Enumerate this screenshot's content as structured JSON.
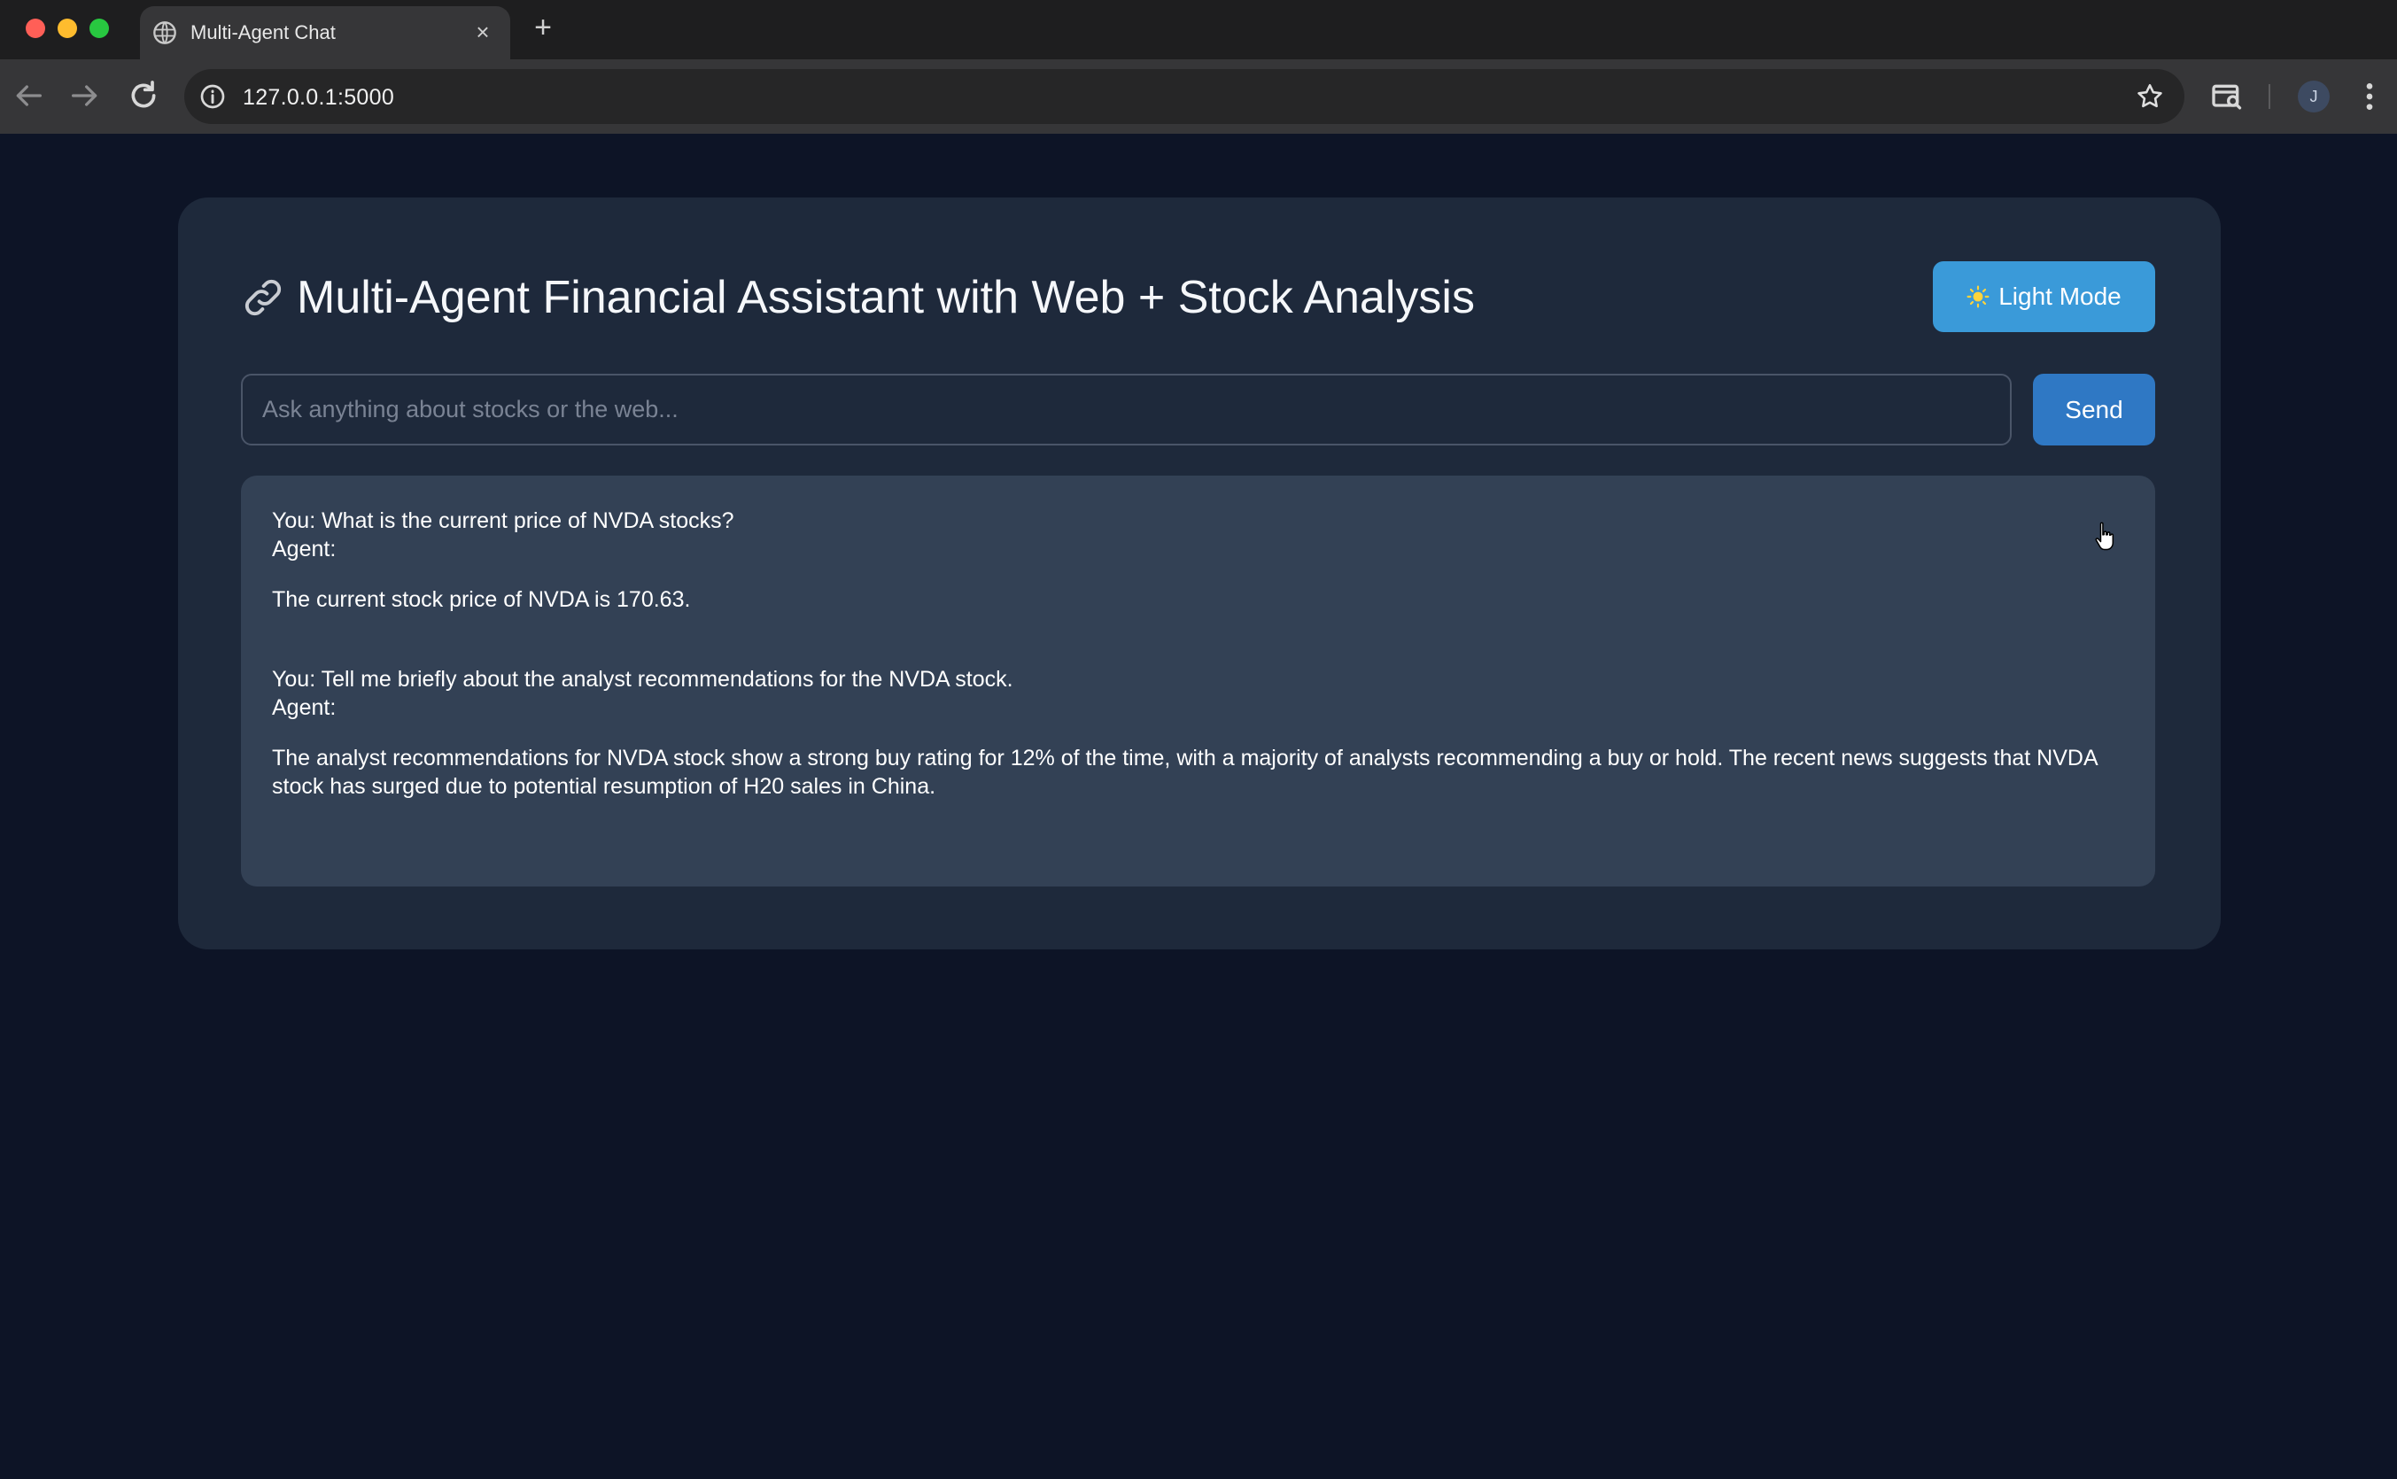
{
  "browser": {
    "tab_title": "Multi-Agent Chat",
    "tab_close": "×",
    "new_tab": "+",
    "url": "127.0.0.1:5000",
    "profile_initial": "J"
  },
  "app": {
    "title": "Multi-Agent Financial Assistant with Web + Stock Analysis",
    "mode_button_label": "Light Mode",
    "input_placeholder": "Ask anything about stocks or the web...",
    "input_value": "",
    "send_label": "Send"
  },
  "chat": [
    {
      "user": "You: What is the current price of NVDA stocks?",
      "agent_label": "Agent:",
      "agent": "The current stock price of NVDA is 170.63."
    },
    {
      "user": "You: Tell me briefly about the analyst recommendations for the NVDA stock.",
      "agent_label": "Agent:",
      "agent": "The analyst recommendations for NVDA stock show a strong buy rating for 12% of the time, with a majority of analysts recommending a buy or hold. The recent news suggests that NVDA stock has surged due to potential resumption of H20 sales in China."
    }
  ],
  "colors": {
    "page_bg": "#0d1426",
    "card_bg": "#1e293b",
    "chat_bg": "#334155",
    "mode_button": "#3a9ad9",
    "send_button": "#2f78c4"
  },
  "icons": {
    "title": "link-icon",
    "mode_button": "sun-icon",
    "tab": "globe-icon"
  }
}
